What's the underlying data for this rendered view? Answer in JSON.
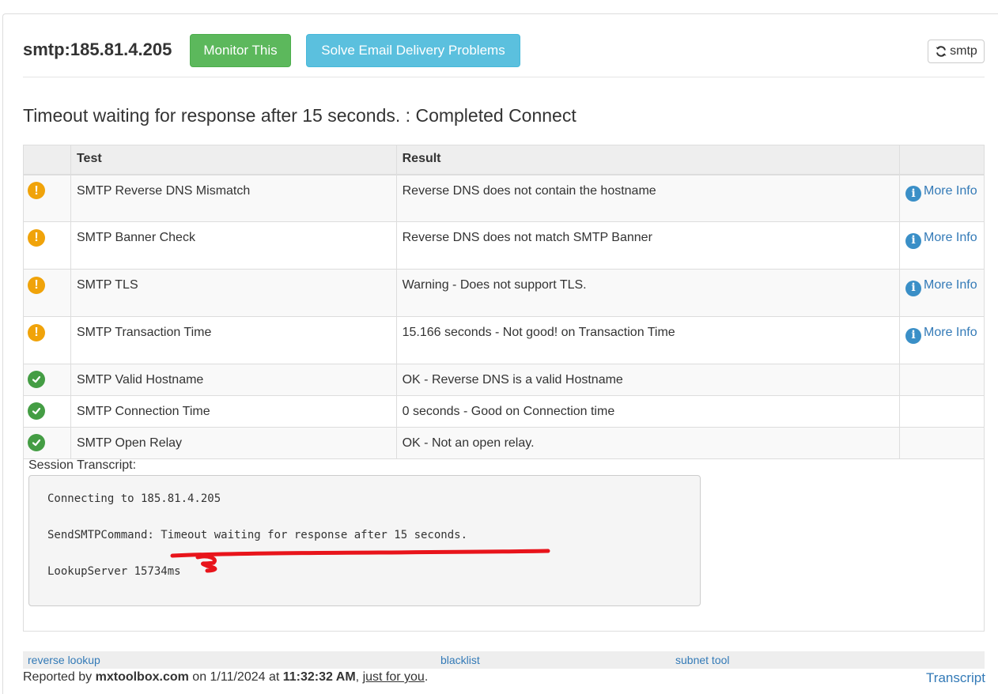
{
  "header": {
    "title": "smtp:185.81.4.205",
    "monitor_button": "Monitor This",
    "solve_button": "Solve Email Delivery Problems",
    "refresh_button": "smtp",
    "colors": {
      "green": "#5cb85c",
      "blue": "#5bc0de"
    }
  },
  "headline": "Timeout waiting for response after 15 seconds. : Completed Connect",
  "table": {
    "columns": [
      "",
      "Test",
      "Result",
      ""
    ],
    "rows": [
      {
        "status": "warning",
        "test": "SMTP Reverse DNS Mismatch",
        "result": "Reverse DNS does not contain the hostname",
        "more": "More Info"
      },
      {
        "status": "warning",
        "test": "SMTP Banner Check",
        "result": "Reverse DNS does not match SMTP Banner",
        "more": "More Info"
      },
      {
        "status": "warning",
        "test": "SMTP TLS",
        "result": "Warning - Does not support TLS.",
        "more": "More Info"
      },
      {
        "status": "warning",
        "test": "SMTP Transaction Time",
        "result": "15.166 seconds - Not good! on Transaction Time",
        "more": "More Info"
      },
      {
        "status": "ok",
        "test": "SMTP Valid Hostname",
        "result": "OK - Reverse DNS is a valid Hostname",
        "more": ""
      },
      {
        "status": "ok",
        "test": "SMTP Connection Time",
        "result": "0 seconds - Good on Connection time",
        "more": ""
      },
      {
        "status": "ok",
        "test": "SMTP Open Relay",
        "result": "OK - Not an open relay.",
        "more": ""
      }
    ]
  },
  "transcript": {
    "label": "Session Transcript:",
    "lines": [
      "Connecting to 185.81.4.205",
      "",
      "SendSMTPCommand: Timeout waiting for response after 15 seconds.",
      "",
      "LookupServer 15734ms"
    ],
    "annotation_color": "#e8141b"
  },
  "footer": {
    "links": [
      "reverse lookup",
      "blacklist",
      "subnet tool"
    ],
    "reported_prefix": "Reported by ",
    "reported_site": "mxtoolbox.com",
    "reported_on": " on 1/11/2024 at ",
    "reported_time": "11:32:32 AM",
    "reported_sep": ", ",
    "reported_link": "just for you",
    "reported_end": ".",
    "transcript_link": "Transcript"
  }
}
